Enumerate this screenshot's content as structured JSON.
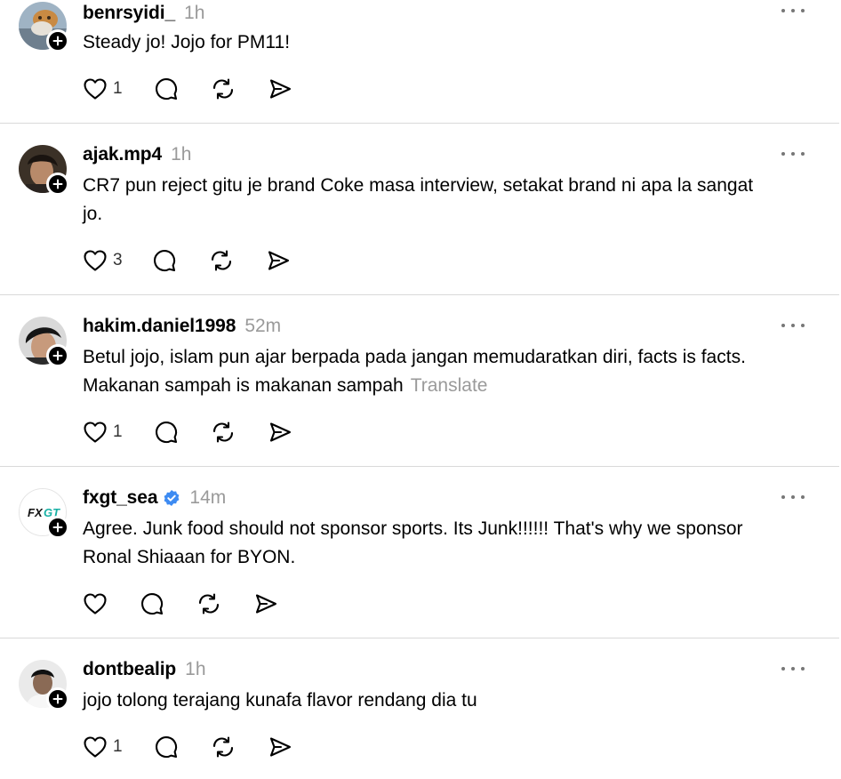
{
  "posts": [
    {
      "username": "benrsyidi_",
      "time": "1h",
      "verified": false,
      "text": "Steady jo! Jojo for PM11!",
      "translate": "",
      "likes": "1",
      "avatar": "photo-avatar-cat"
    },
    {
      "username": "ajak.mp4",
      "time": "1h",
      "verified": false,
      "text": "CR7 pun reject gitu je brand Coke masa interview, setakat brand ni apa la sangat jo.",
      "translate": "",
      "likes": "3",
      "avatar": "photo-avatar-person"
    },
    {
      "username": "hakim.daniel1998",
      "time": "52m",
      "verified": false,
      "text": "Betul jojo, islam pun ajar berpada pada jangan memudaratkan diri, facts is facts. Makanan sampah is makanan sampah",
      "translate": "Translate",
      "likes": "1",
      "avatar": "photo-avatar-person"
    },
    {
      "username": "fxgt_sea",
      "time": "14m",
      "verified": true,
      "text": "Agree. Junk food should not sponsor sports. Its Junk!!!!!! That's why we sponsor Ronal Shiaaan for BYON.",
      "translate": "",
      "likes": "",
      "avatar": "logo-avatar",
      "logo_text": "FXGT"
    },
    {
      "username": "dontbealip",
      "time": "1h",
      "verified": false,
      "text": "jojo tolong terajang kunafa flavor rendang dia tu",
      "translate": "",
      "likes": "1",
      "avatar": "photo-avatar-person"
    }
  ],
  "icons": {
    "like": "heart-icon",
    "reply": "comment-icon",
    "repost": "repost-icon",
    "share": "send-icon",
    "more": "more-dots-icon",
    "follow": "plus-icon",
    "verified": "verified-badge-icon"
  },
  "colors": {
    "text": "#000000",
    "muted": "#9a9a9a",
    "divider": "#d9d9d9",
    "verified": "#3d8bf2"
  }
}
